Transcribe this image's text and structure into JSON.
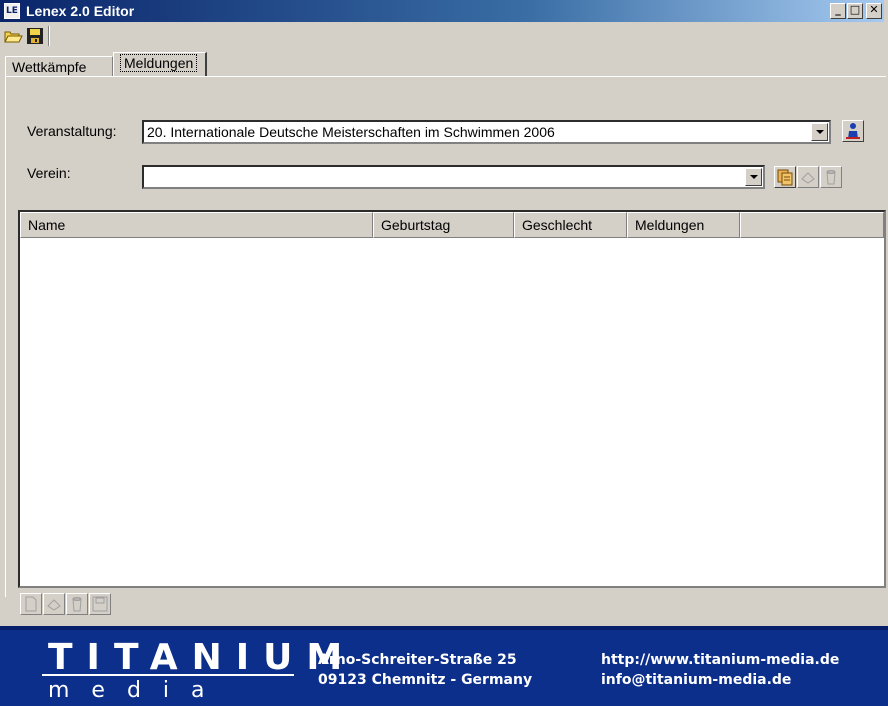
{
  "window": {
    "title": "Lenex 2.0 Editor",
    "app_icon_text": "LE",
    "minimize": "_",
    "maximize": "□",
    "close": "✕"
  },
  "toolbar": {
    "open_icon": "folder-open-icon",
    "save_icon": "floppy-disk-icon"
  },
  "tabs": [
    {
      "label": "Wettkämpfe",
      "active": false
    },
    {
      "label": "Meldungen",
      "active": true
    }
  ],
  "form": {
    "event_label": "Veranstaltung:",
    "event_value": "20. Internationale Deutsche Meisterschaften im Schwimmen 2006",
    "club_label": "Verein:",
    "club_value": ""
  },
  "table": {
    "columns": [
      "Name",
      "Geburtstag",
      "Geschlecht",
      "Meldungen"
    ],
    "rows": []
  },
  "footer": {
    "logo_top": "TITANIUM",
    "logo_bottom": "media",
    "address_line1": "Arno-Schreiter-Straße 25",
    "address_line2": "09123 Chemnitz - Germany",
    "web": "http://www.titanium-media.de",
    "email": "info@titanium-media.de",
    "background_color": "#0c2f8c"
  }
}
